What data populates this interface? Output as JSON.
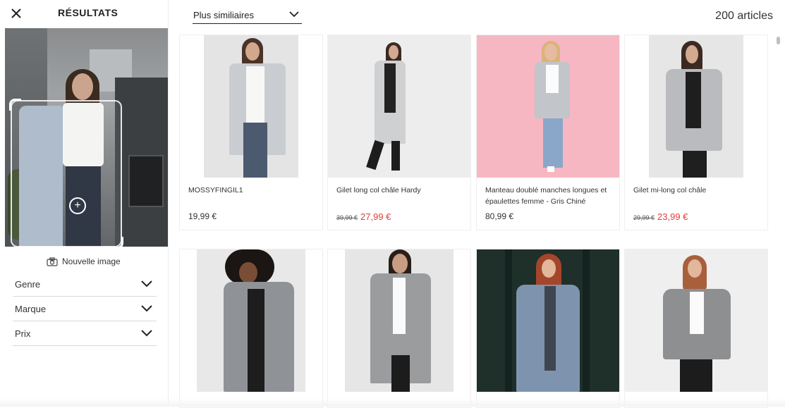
{
  "left_panel": {
    "title": "RÉSULTATS",
    "new_image_label": "Nouvelle image",
    "filters": [
      {
        "label": "Genre"
      },
      {
        "label": "Marque"
      },
      {
        "label": "Prix"
      }
    ]
  },
  "topbar": {
    "sort_label": "Plus similiaires",
    "count_label": "200 articles"
  },
  "products": [
    {
      "name": "MOSSYFINGIL1",
      "price": "19,99 €",
      "old_price": "",
      "sale_price": ""
    },
    {
      "name": "Gilet long col châle Hardy",
      "price": "",
      "old_price": "39,99 €",
      "sale_price": "27,99 €"
    },
    {
      "name": "Manteau doublé manches longues et épaulettes femme - Gris Chiné",
      "price": "80,99 €",
      "old_price": "",
      "sale_price": ""
    },
    {
      "name": "Gilet mi-long col châle",
      "price": "",
      "old_price": "29,99 €",
      "sale_price": "23,99 €"
    },
    {
      "name": "",
      "price": "",
      "old_price": "",
      "sale_price": ""
    },
    {
      "name": "",
      "price": "",
      "old_price": "",
      "sale_price": ""
    },
    {
      "name": "",
      "price": "",
      "old_price": "",
      "sale_price": ""
    },
    {
      "name": "",
      "price": "",
      "old_price": "",
      "sale_price": ""
    }
  ],
  "colors": {
    "sale": "#e0403a",
    "pink_backdrop": "#f6b7c3",
    "dark_backdrop": "#1f2f2a"
  }
}
